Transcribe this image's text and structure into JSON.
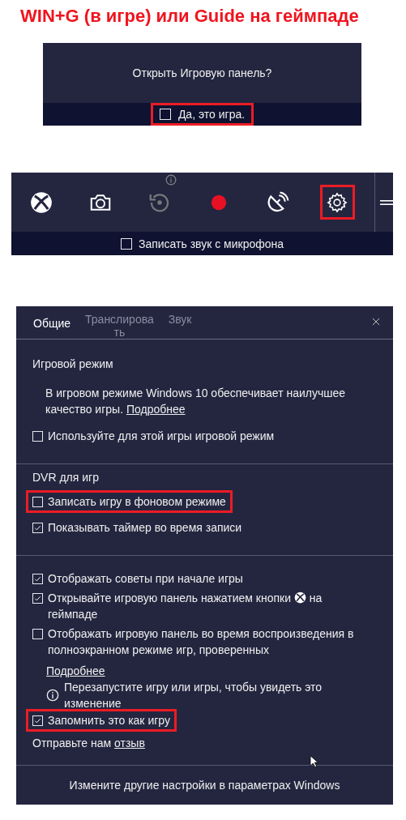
{
  "heading": "WIN+G (в игре) или Guide на геймпаде",
  "prompt": {
    "question": "Открыть Игровую панель?",
    "checkbox": {
      "label": "Да, это игра.",
      "checked": false,
      "highlighted": true
    }
  },
  "game_bar": {
    "buttons": [
      {
        "kind": "xbox",
        "disabled": false,
        "highlighted": false
      },
      {
        "kind": "camera",
        "disabled": false,
        "highlighted": false
      },
      {
        "kind": "replay",
        "disabled": true,
        "highlighted": false
      },
      {
        "kind": "record",
        "disabled": false,
        "highlighted": false
      },
      {
        "kind": "broadcast",
        "disabled": false,
        "highlighted": false
      },
      {
        "kind": "settings",
        "disabled": false,
        "highlighted": true
      }
    ],
    "checkbox": {
      "label": "Записать звук с микрофона",
      "checked": false
    }
  },
  "settings": {
    "tabs": [
      {
        "label_lines": [
          "Общие"
        ],
        "selected": true
      },
      {
        "label_lines": [
          "Транслирова",
          "ть"
        ],
        "selected": false
      },
      {
        "label_lines": [
          "Звук"
        ],
        "selected": false
      }
    ],
    "sections": [
      {
        "title": "Игровой режим",
        "items": [
          {
            "kind": "paragraph",
            "text": "В игровом режиме Windows 10 обеспечивает наилучшее качество игры.",
            "link": "Подробнее"
          },
          {
            "kind": "checkbox",
            "label": "Используйте для этой игры игровой режим",
            "checked": false,
            "highlighted": false
          }
        ]
      },
      {
        "title": "DVR для игр",
        "items": [
          {
            "kind": "checkbox",
            "label": "Записать игру в фоновом режиме",
            "checked": false,
            "highlighted": true
          },
          {
            "kind": "checkbox",
            "label": "Показывать таймер во время записи",
            "checked": true,
            "highlighted": false
          }
        ]
      },
      {
        "items": [
          {
            "kind": "checkbox",
            "label": "Отображать советы при начале игры",
            "checked": true,
            "highlighted": false
          },
          {
            "kind": "checkbox",
            "label": "Открывайте игровую панель нажатием кнопки",
            "label_after": "на геймпаде",
            "checked": true,
            "highlighted": false
          },
          {
            "kind": "checkbox",
            "label": "Отображать игровую панель во время воспроизведения в полноэкранном режиме игр, проверенных",
            "checked": false,
            "highlighted": false
          },
          {
            "kind": "link",
            "text": "Подробнее"
          },
          {
            "kind": "info",
            "text": "Перезапустите игру или игры, чтобы увидеть это изменение"
          },
          {
            "kind": "checkbox",
            "label": "Запомнить это как игру",
            "checked": true,
            "highlighted": true
          },
          {
            "kind": "feedback",
            "text": "Отправьте нам",
            "link": "отзыв"
          }
        ]
      }
    ],
    "footer": "Измените другие настройки в параметрах Windows"
  }
}
